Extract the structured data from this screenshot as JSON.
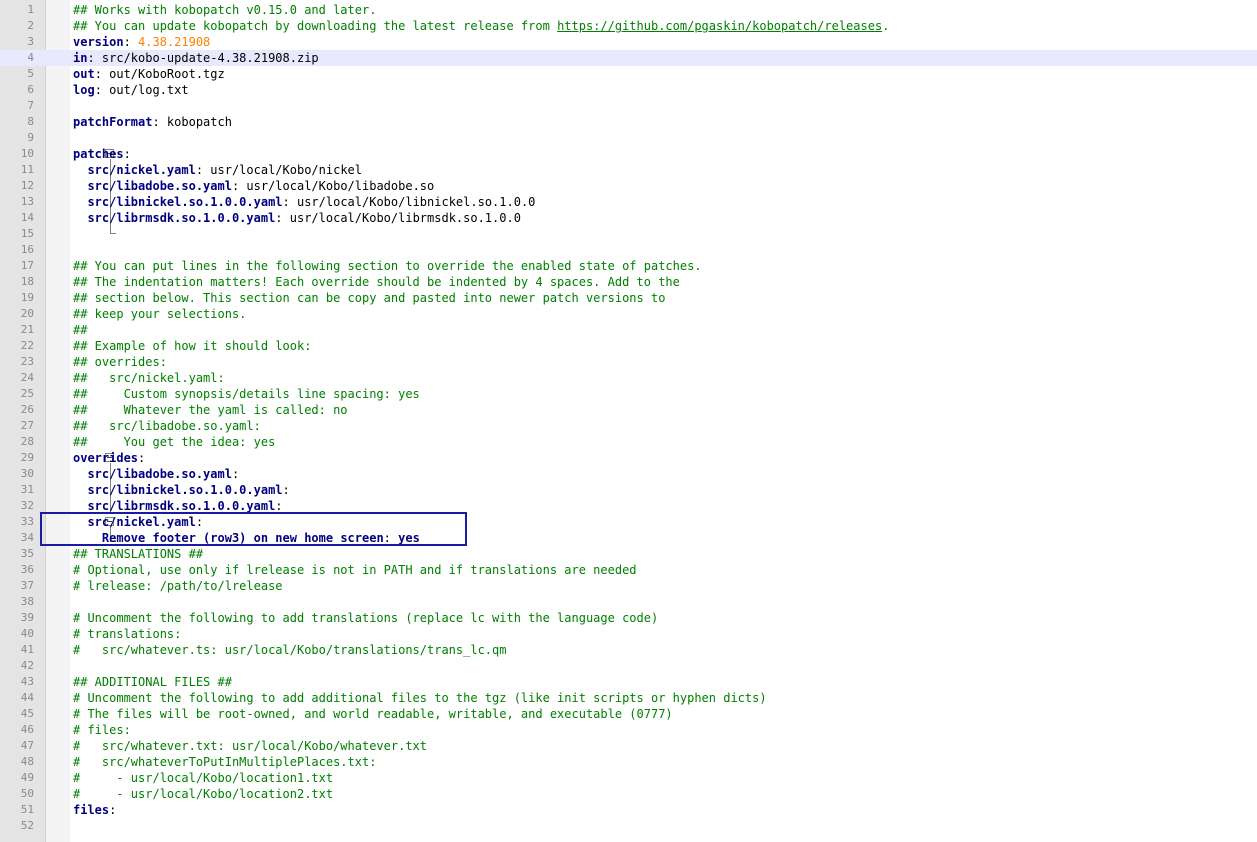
{
  "editor": {
    "current_line": 4,
    "lines": [
      {
        "n": "1",
        "t": [
          [
            "c",
            "## Works with kobopatch v0.15.0 and later."
          ]
        ]
      },
      {
        "n": "2",
        "t": [
          [
            "c",
            "## You can update kobopatch by downloading the latest release from "
          ],
          [
            "cu",
            "https://github.com/pgaskin/kobopatch/releases"
          ],
          [
            "c",
            "."
          ]
        ]
      },
      {
        "n": "3",
        "t": [
          [
            "k",
            "version"
          ],
          [
            "p",
            ": "
          ],
          [
            "n",
            "4.38.21908"
          ]
        ]
      },
      {
        "n": "4",
        "t": [
          [
            "k",
            "in"
          ],
          [
            "p",
            ": src/kobo-update-4.38.21908.zip"
          ]
        ]
      },
      {
        "n": "5",
        "t": [
          [
            "k",
            "out"
          ],
          [
            "p",
            ": out/KoboRoot.tgz"
          ]
        ]
      },
      {
        "n": "6",
        "t": [
          [
            "k",
            "log"
          ],
          [
            "p",
            ": out/log.txt"
          ]
        ]
      },
      {
        "n": "7",
        "t": []
      },
      {
        "n": "8",
        "t": [
          [
            "k",
            "patchFormat"
          ],
          [
            "p",
            ": kobopatch"
          ]
        ]
      },
      {
        "n": "9",
        "t": []
      },
      {
        "n": "10",
        "t": [
          [
            "k",
            "patches"
          ],
          [
            "p",
            ":"
          ]
        ]
      },
      {
        "n": "11",
        "t": [
          [
            "p",
            "  "
          ],
          [
            "k",
            "src/nickel.yaml"
          ],
          [
            "p",
            ": usr/local/Kobo/nickel"
          ]
        ]
      },
      {
        "n": "12",
        "t": [
          [
            "p",
            "  "
          ],
          [
            "k",
            "src/libadobe.so.yaml"
          ],
          [
            "p",
            ": usr/local/Kobo/libadobe.so"
          ]
        ]
      },
      {
        "n": "13",
        "t": [
          [
            "p",
            "  "
          ],
          [
            "k",
            "src/libnickel.so.1.0.0.yaml"
          ],
          [
            "p",
            ": usr/local/Kobo/libnickel.so.1.0.0"
          ]
        ]
      },
      {
        "n": "14",
        "t": [
          [
            "p",
            "  "
          ],
          [
            "k",
            "src/librmsdk.so.1.0.0.yaml"
          ],
          [
            "p",
            ": usr/local/Kobo/librmsdk.so.1.0.0"
          ]
        ]
      },
      {
        "n": "15",
        "t": []
      },
      {
        "n": "16",
        "t": []
      },
      {
        "n": "17",
        "t": [
          [
            "c",
            "## You can put lines in the following section to override the enabled state of patches."
          ]
        ]
      },
      {
        "n": "18",
        "t": [
          [
            "c",
            "## The indentation matters! Each override should be indented by 4 spaces. Add to the"
          ]
        ]
      },
      {
        "n": "19",
        "t": [
          [
            "c",
            "## section below. This section can be copy and pasted into newer patch versions to"
          ]
        ]
      },
      {
        "n": "20",
        "t": [
          [
            "c",
            "## keep your selections."
          ]
        ]
      },
      {
        "n": "21",
        "t": [
          [
            "c",
            "##"
          ]
        ]
      },
      {
        "n": "22",
        "t": [
          [
            "c",
            "## Example of how it should look:"
          ]
        ]
      },
      {
        "n": "23",
        "t": [
          [
            "c",
            "## overrides:"
          ]
        ]
      },
      {
        "n": "24",
        "t": [
          [
            "c",
            "##   src/nickel.yaml:"
          ]
        ]
      },
      {
        "n": "25",
        "t": [
          [
            "c",
            "##     Custom synopsis/details line spacing: yes"
          ]
        ]
      },
      {
        "n": "26",
        "t": [
          [
            "c",
            "##     Whatever the yaml is called: no"
          ]
        ]
      },
      {
        "n": "27",
        "t": [
          [
            "c",
            "##   src/libadobe.so.yaml:"
          ]
        ]
      },
      {
        "n": "28",
        "t": [
          [
            "c",
            "##     You get the idea: yes"
          ]
        ]
      },
      {
        "n": "29",
        "t": [
          [
            "k",
            "overrides"
          ],
          [
            "p",
            ":"
          ]
        ]
      },
      {
        "n": "30",
        "t": [
          [
            "p",
            "  "
          ],
          [
            "k",
            "src/libadobe.so.yaml"
          ],
          [
            "p",
            ":"
          ]
        ]
      },
      {
        "n": "31",
        "t": [
          [
            "p",
            "  "
          ],
          [
            "k",
            "src/libnickel.so.1.0.0.yaml"
          ],
          [
            "p",
            ":"
          ]
        ]
      },
      {
        "n": "32",
        "t": [
          [
            "p",
            "  "
          ],
          [
            "k",
            "src/librmsdk.so.1.0.0.yaml"
          ],
          [
            "p",
            ":"
          ]
        ]
      },
      {
        "n": "33",
        "t": [
          [
            "p",
            "  "
          ],
          [
            "k",
            "src/nickel.yaml"
          ],
          [
            "p",
            ":"
          ]
        ]
      },
      {
        "n": "34",
        "t": [
          [
            "p",
            "    "
          ],
          [
            "k",
            "Remove footer (row3) on new home screen"
          ],
          [
            "p",
            ": "
          ],
          [
            "k",
            "yes"
          ]
        ]
      },
      {
        "n": "35",
        "t": [
          [
            "c",
            "## TRANSLATIONS ##"
          ]
        ]
      },
      {
        "n": "36",
        "t": [
          [
            "c",
            "# Optional, use only if lrelease is not in PATH and if translations are needed"
          ]
        ]
      },
      {
        "n": "37",
        "t": [
          [
            "c",
            "# lrelease: /path/to/lrelease"
          ]
        ]
      },
      {
        "n": "38",
        "t": []
      },
      {
        "n": "39",
        "t": [
          [
            "c",
            "# Uncomment the following to add translations (replace lc with the language code)"
          ]
        ]
      },
      {
        "n": "40",
        "t": [
          [
            "c",
            "# translations:"
          ]
        ]
      },
      {
        "n": "41",
        "t": [
          [
            "c",
            "#   src/whatever.ts: usr/local/Kobo/translations/trans_lc.qm"
          ]
        ]
      },
      {
        "n": "42",
        "t": []
      },
      {
        "n": "43",
        "t": [
          [
            "c",
            "## ADDITIONAL FILES ##"
          ]
        ]
      },
      {
        "n": "44",
        "t": [
          [
            "c",
            "# Uncomment the following to add additional files to the tgz (like init scripts or hyphen dicts)"
          ]
        ]
      },
      {
        "n": "45",
        "t": [
          [
            "c",
            "# The files will be root-owned, and world readable, writable, and executable (0777)"
          ]
        ]
      },
      {
        "n": "46",
        "t": [
          [
            "c",
            "# files:"
          ]
        ]
      },
      {
        "n": "47",
        "t": [
          [
            "c",
            "#   src/whatever.txt: usr/local/Kobo/whatever.txt"
          ]
        ]
      },
      {
        "n": "48",
        "t": [
          [
            "c",
            "#   src/whateverToPutInMultiplePlaces.txt:"
          ]
        ]
      },
      {
        "n": "49",
        "t": [
          [
            "c",
            "#     - usr/local/Kobo/location1.txt"
          ]
        ]
      },
      {
        "n": "50",
        "t": [
          [
            "c",
            "#     - usr/local/Kobo/location2.txt"
          ]
        ]
      },
      {
        "n": "51",
        "t": [
          [
            "k",
            "files"
          ],
          [
            "p",
            ":"
          ]
        ]
      },
      {
        "n": "52",
        "t": []
      }
    ]
  },
  "icons": {
    "fold_markers": "fold-box-minus-icon"
  },
  "colors": {
    "keyword": "#000080",
    "comment": "#008000",
    "number": "#ff8000",
    "highlight_border": "#1a1aa6"
  }
}
